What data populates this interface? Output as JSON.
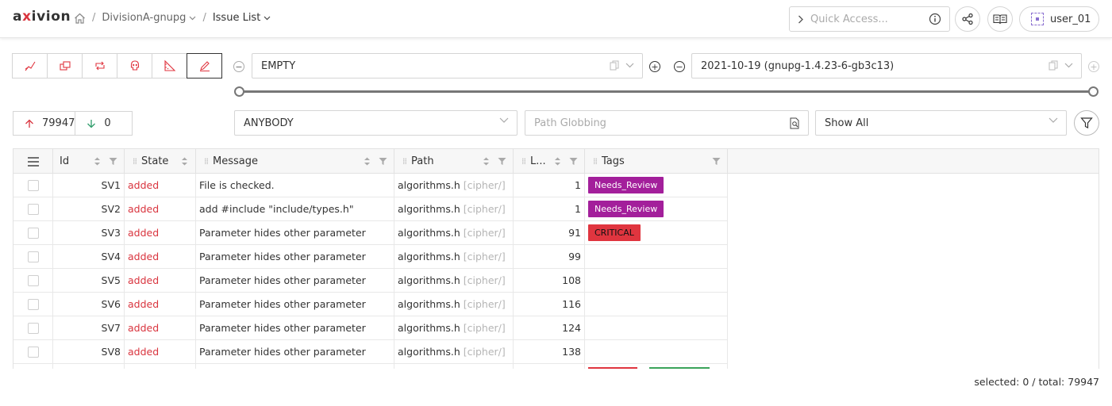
{
  "header": {
    "logo_prefix": "a",
    "logo_x": "x",
    "logo_suffix": "ivion",
    "breadcrumbs": [
      {
        "label": "DivisionA-gnupg"
      },
      {
        "label": "Issue List"
      }
    ],
    "quick_access_placeholder": "Quick Access...",
    "user_label": "user_01"
  },
  "toolbar": {
    "metric_icons": [
      "trend-icon",
      "clone-icon",
      "cycle-icon",
      "skull-icon",
      "ruler-icon",
      "pen-icon"
    ],
    "base_version": "EMPTY",
    "target_version": "2021-10-19 (gnupg-1.4.23-6-gb3c13)",
    "added_count": "79947",
    "removed_count": "0",
    "owner_filter": "ANYBODY",
    "path_placeholder": "Path Globbing",
    "show_filter": "Show All"
  },
  "table": {
    "columns": [
      "Id",
      "State",
      "Message",
      "Path",
      "L...",
      "Tags"
    ],
    "rows": [
      {
        "id": "SV1",
        "state": "added",
        "message": "File is checked.",
        "path": "algorithms.h",
        "dir": "[cipher/]",
        "line": "1",
        "tags": [
          "Needs_Review"
        ]
      },
      {
        "id": "SV2",
        "state": "added",
        "message": "add #include \"include/types.h\"",
        "path": "algorithms.h",
        "dir": "[cipher/]",
        "line": "1",
        "tags": [
          "Needs_Review"
        ]
      },
      {
        "id": "SV3",
        "state": "added",
        "message": "Parameter hides other parameter",
        "path": "algorithms.h",
        "dir": "[cipher/]",
        "line": "91",
        "tags": [
          "CRITICAL"
        ]
      },
      {
        "id": "SV4",
        "state": "added",
        "message": "Parameter hides other parameter",
        "path": "algorithms.h",
        "dir": "[cipher/]",
        "line": "99",
        "tags": []
      },
      {
        "id": "SV5",
        "state": "added",
        "message": "Parameter hides other parameter",
        "path": "algorithms.h",
        "dir": "[cipher/]",
        "line": "108",
        "tags": []
      },
      {
        "id": "SV6",
        "state": "added",
        "message": "Parameter hides other parameter",
        "path": "algorithms.h",
        "dir": "[cipher/]",
        "line": "116",
        "tags": []
      },
      {
        "id": "SV7",
        "state": "added",
        "message": "Parameter hides other parameter",
        "path": "algorithms.h",
        "dir": "[cipher/]",
        "line": "124",
        "tags": []
      },
      {
        "id": "SV8",
        "state": "added",
        "message": "Parameter hides other parameter",
        "path": "algorithms.h",
        "dir": "[cipher/]",
        "line": "138",
        "tags": []
      }
    ]
  },
  "footer": {
    "status": "selected: 0 / total: 79947"
  },
  "colors": {
    "accent_red": "#d9343e",
    "tag_review": "#a31f9b",
    "tag_critical": "#e0353f"
  }
}
